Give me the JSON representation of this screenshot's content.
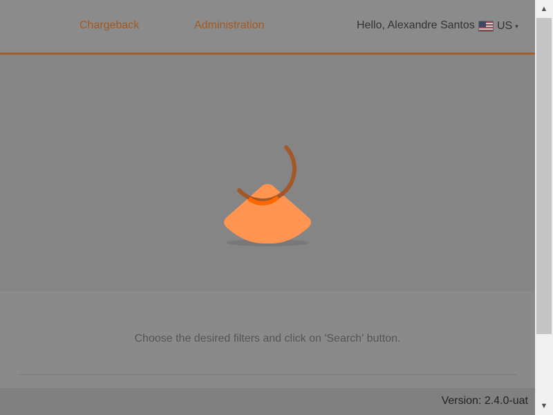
{
  "header": {
    "nav": [
      {
        "label": "Chargeback"
      },
      {
        "label": "Administration"
      }
    ],
    "greeting": "Hello, Alexandre Santos",
    "locale": {
      "code": "US",
      "flag_icon": "us-flag-icon",
      "caret": "▾"
    },
    "accent_color": "#a15e2f"
  },
  "loader": {
    "icon": "loading-spinner-icon",
    "colors": {
      "cone": "#ff9550",
      "ring": "#a4582a",
      "ring_overlap": "#ff6600"
    }
  },
  "results": {
    "hint": "Choose the desired filters and click on 'Search' button."
  },
  "footer": {
    "version": "Version: 2.4.0-uat"
  },
  "scrollbar": {
    "up_glyph": "▲",
    "down_glyph": "▼",
    "position": 0.0
  }
}
